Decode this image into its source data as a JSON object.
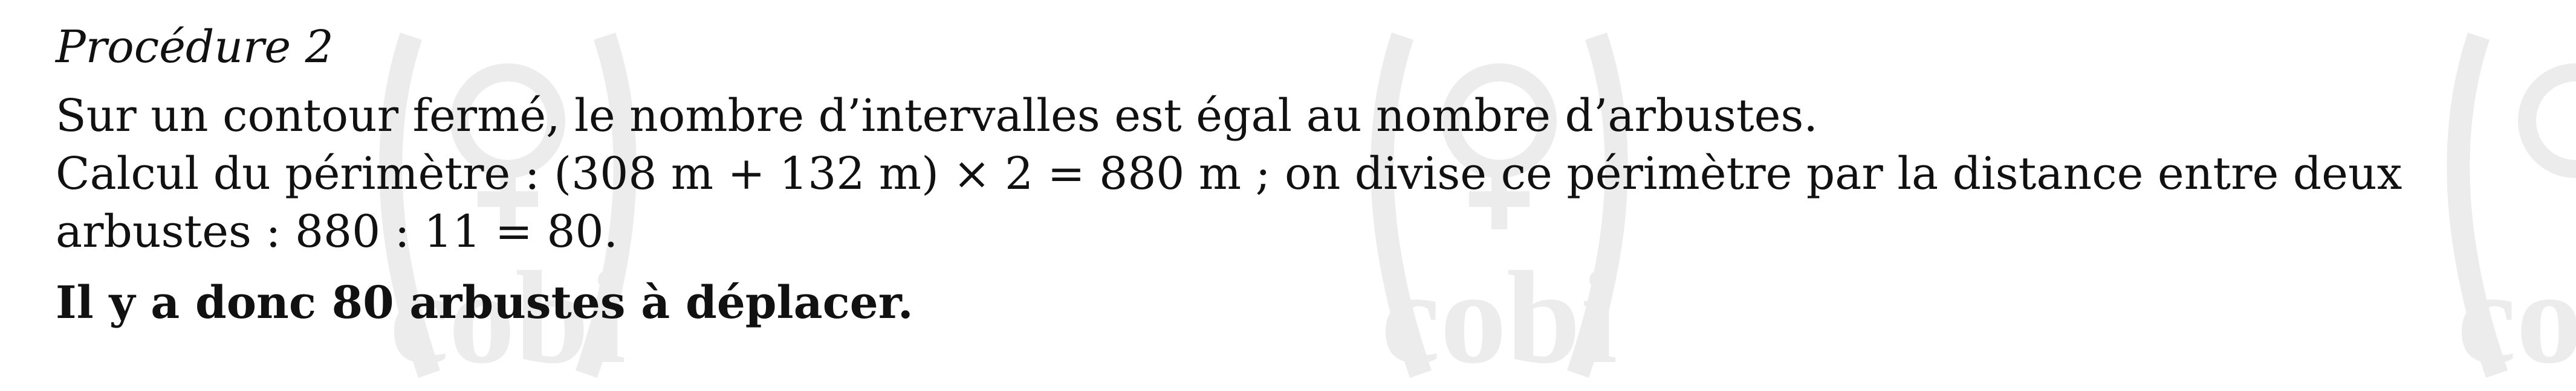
{
  "document": {
    "heading": "Procédure 2",
    "lines": [
      "Sur un contour fermé, le nombre d’intervalles est égal au nombre d’arbustes.",
      "Calcul du périmètre : (308 m +  132 m)  ×  2  =  880 m ; on divise ce périmètre par la distance entre deux",
      "arbustes : 880 : 11  =  80."
    ],
    "conclusion": "Il y a donc 80 arbustes à déplacer."
  },
  "watermark": {
    "text": "cobi",
    "color": "#000000"
  }
}
